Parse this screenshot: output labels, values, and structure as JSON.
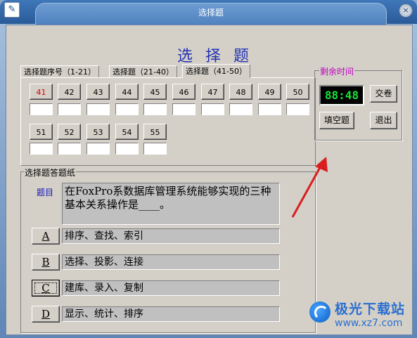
{
  "window": {
    "title": "选择题",
    "close_glyph": "×",
    "app_icon_glyph": "✎"
  },
  "heading": "选择题",
  "tabs": [
    {
      "label": "选择题序号（1-21）",
      "active": false
    },
    {
      "label": "选择题（21-40）",
      "active": false
    },
    {
      "label": "选择题（41-50）",
      "active": true
    }
  ],
  "questions": [
    "41",
    "42",
    "43",
    "44",
    "45",
    "46",
    "47",
    "48",
    "49",
    "50",
    "51",
    "52",
    "53",
    "54",
    "55"
  ],
  "questions_red": [
    "41"
  ],
  "timer": {
    "group_label": "剩余时间",
    "value": "88:48",
    "submit_label": "交卷"
  },
  "fill_blank_label": "填空题",
  "exit_label": "退出",
  "answer_sheet": {
    "group_label": "选择题答题纸",
    "question_label": "题目",
    "question_text": "在FoxPro系数据库管理系统能够实现的三种基本关系操作是____。",
    "options": [
      {
        "key": "A",
        "text": "排序、查找、索引"
      },
      {
        "key": "B",
        "text": "选择、投影、连接"
      },
      {
        "key": "C",
        "text": "建库、录入、复制"
      },
      {
        "key": "D",
        "text": "显示、统计、排序"
      }
    ]
  },
  "colors": {
    "accent_blue": "#2433b3",
    "timer_green": "#19e33a",
    "timer_label": "#c000c0",
    "arrow_red": "#d81e1e"
  },
  "watermark": {
    "name": "极光下载站",
    "url": "www.xz7.com"
  }
}
